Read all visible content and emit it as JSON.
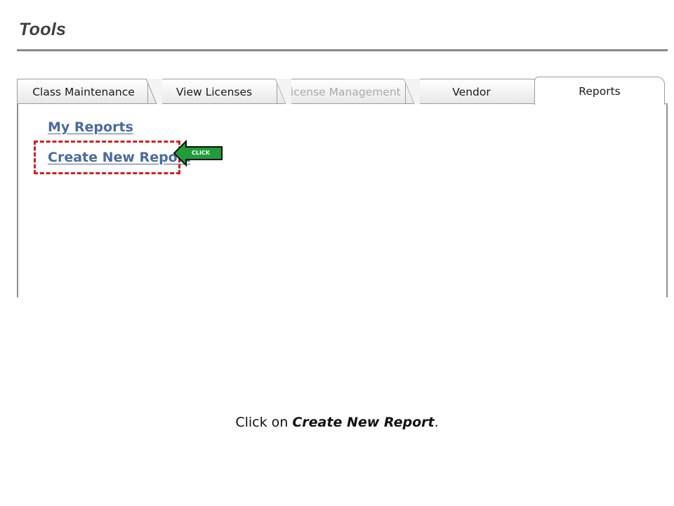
{
  "page": {
    "title": "Tools"
  },
  "tabs": [
    {
      "label": "Class Maintenance",
      "state": "normal"
    },
    {
      "label": "View Licenses",
      "state": "normal"
    },
    {
      "label": "License Management",
      "state": "disabled"
    },
    {
      "label": "Vendor",
      "state": "normal"
    },
    {
      "label": "Reports",
      "state": "active"
    }
  ],
  "panel": {
    "links": {
      "my_reports": "My Reports",
      "create_new_report": "Create New Report"
    }
  },
  "annotation": {
    "click_label": "CLICK",
    "arrow_color": "#1e9e3a",
    "highlight_color": "#d81e1e"
  },
  "caption": {
    "prefix": "Click on ",
    "emphasis": "Create New Report",
    "suffix": "."
  },
  "colors": {
    "link": "#4a6aa1",
    "disabled_tab_text": "#a9a9a9"
  }
}
